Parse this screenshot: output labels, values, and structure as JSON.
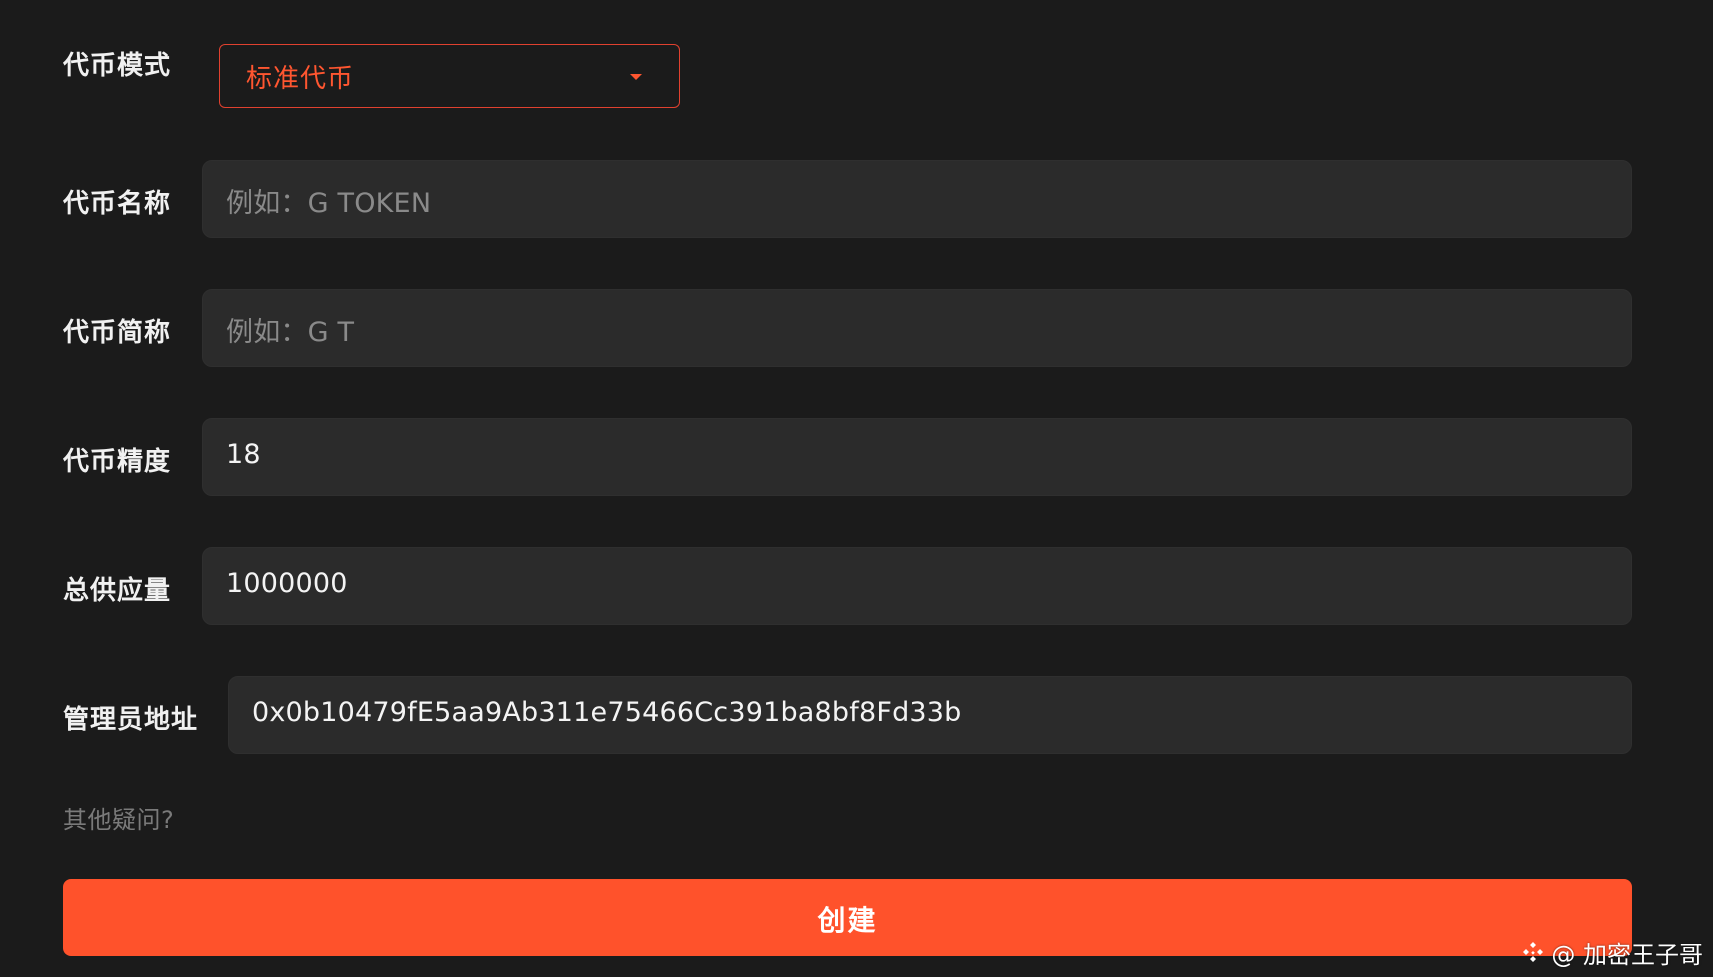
{
  "form": {
    "token_mode": {
      "label": "代币模式",
      "selected_value": "标准代币",
      "accent_color": "#ff5630"
    },
    "token_name": {
      "label": "代币名称",
      "placeholder": "例如：G TOKEN"
    },
    "token_symbol": {
      "label": "代币简称",
      "placeholder": "例如：G T"
    },
    "token_decimals": {
      "label": "代币精度",
      "value": "18"
    },
    "total_supply": {
      "label": "总供应量",
      "value": "1000000"
    },
    "admin_address": {
      "label": "管理员地址",
      "value": "0x0b10479fE5aa9Ab311e75466Cc391ba8bf8Fd33b"
    },
    "faq_link": "其他疑问?",
    "create_button": "创建"
  },
  "watermark": {
    "text": "@ 加密王子哥",
    "icon": "binance-icon"
  },
  "theme": {
    "background": "#1b1b1b",
    "field_background": "#2b2b2b",
    "button_color": "#ff522b"
  }
}
